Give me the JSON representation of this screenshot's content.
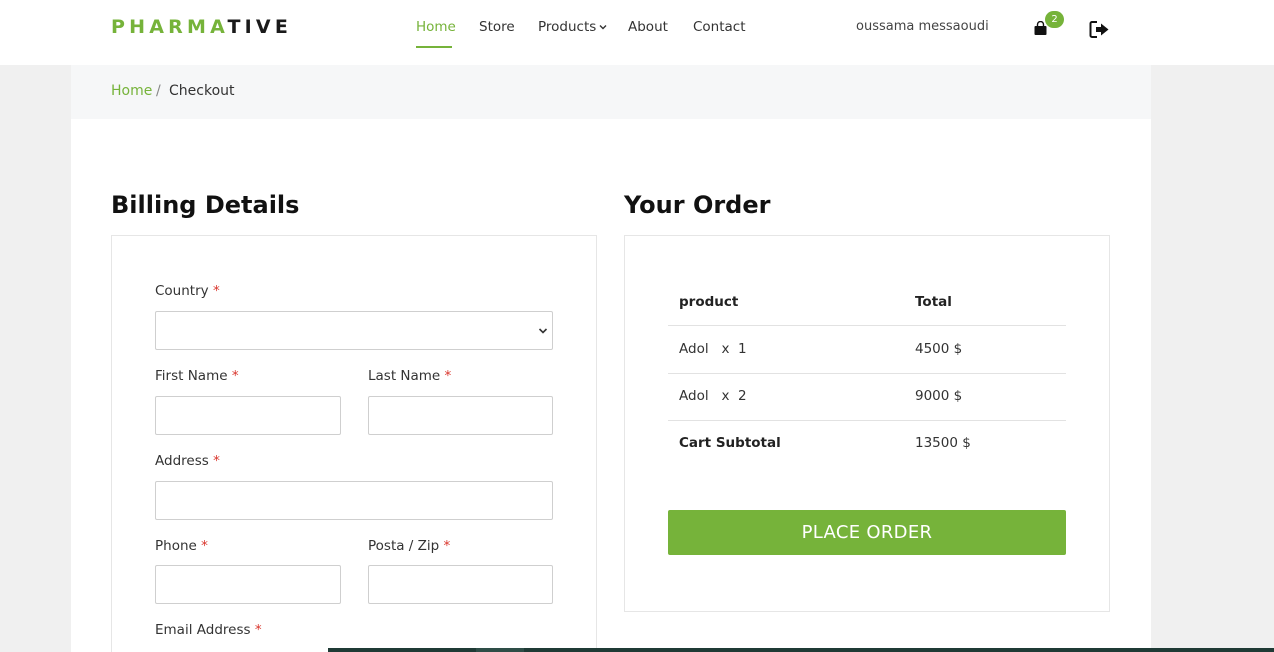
{
  "brand": {
    "part1": "PHARMA",
    "part2": "TIVE",
    "accent_color": "#76b33a"
  },
  "nav": {
    "items": [
      {
        "label": "Home",
        "active": true
      },
      {
        "label": "Store",
        "active": false
      },
      {
        "label": "Products",
        "active": false,
        "has_dropdown": true
      },
      {
        "label": "About",
        "active": false
      },
      {
        "label": "Contact",
        "active": false
      }
    ]
  },
  "user": {
    "name": "oussama messaoudi"
  },
  "cart": {
    "count": "2",
    "icon": "shopping-bag-icon"
  },
  "logout": {
    "icon": "sign-out-icon"
  },
  "breadcrumb": {
    "home": "Home",
    "separator": "/",
    "current": "Checkout"
  },
  "billing": {
    "title": "Billing Details",
    "required_mark": "*",
    "fields": {
      "country": {
        "label": "Country",
        "value": ""
      },
      "first_name": {
        "label": "First Name",
        "value": ""
      },
      "last_name": {
        "label": "Last Name",
        "value": ""
      },
      "address": {
        "label": "Address",
        "value": ""
      },
      "phone": {
        "label": "Phone",
        "value": ""
      },
      "zip": {
        "label": "Posta / Zip",
        "value": ""
      },
      "email": {
        "label": "Email Address",
        "value": ""
      }
    }
  },
  "order": {
    "title": "Your Order",
    "columns": [
      "product",
      "Total"
    ],
    "rows": [
      {
        "product": "Adol   x  1",
        "total": "4500 $"
      },
      {
        "product": "Adol   x  2",
        "total": "9000 $"
      }
    ],
    "subtotal": {
      "label": "Cart Subtotal",
      "value": "13500 $"
    },
    "place_order_label": "PLACE ORDER"
  }
}
